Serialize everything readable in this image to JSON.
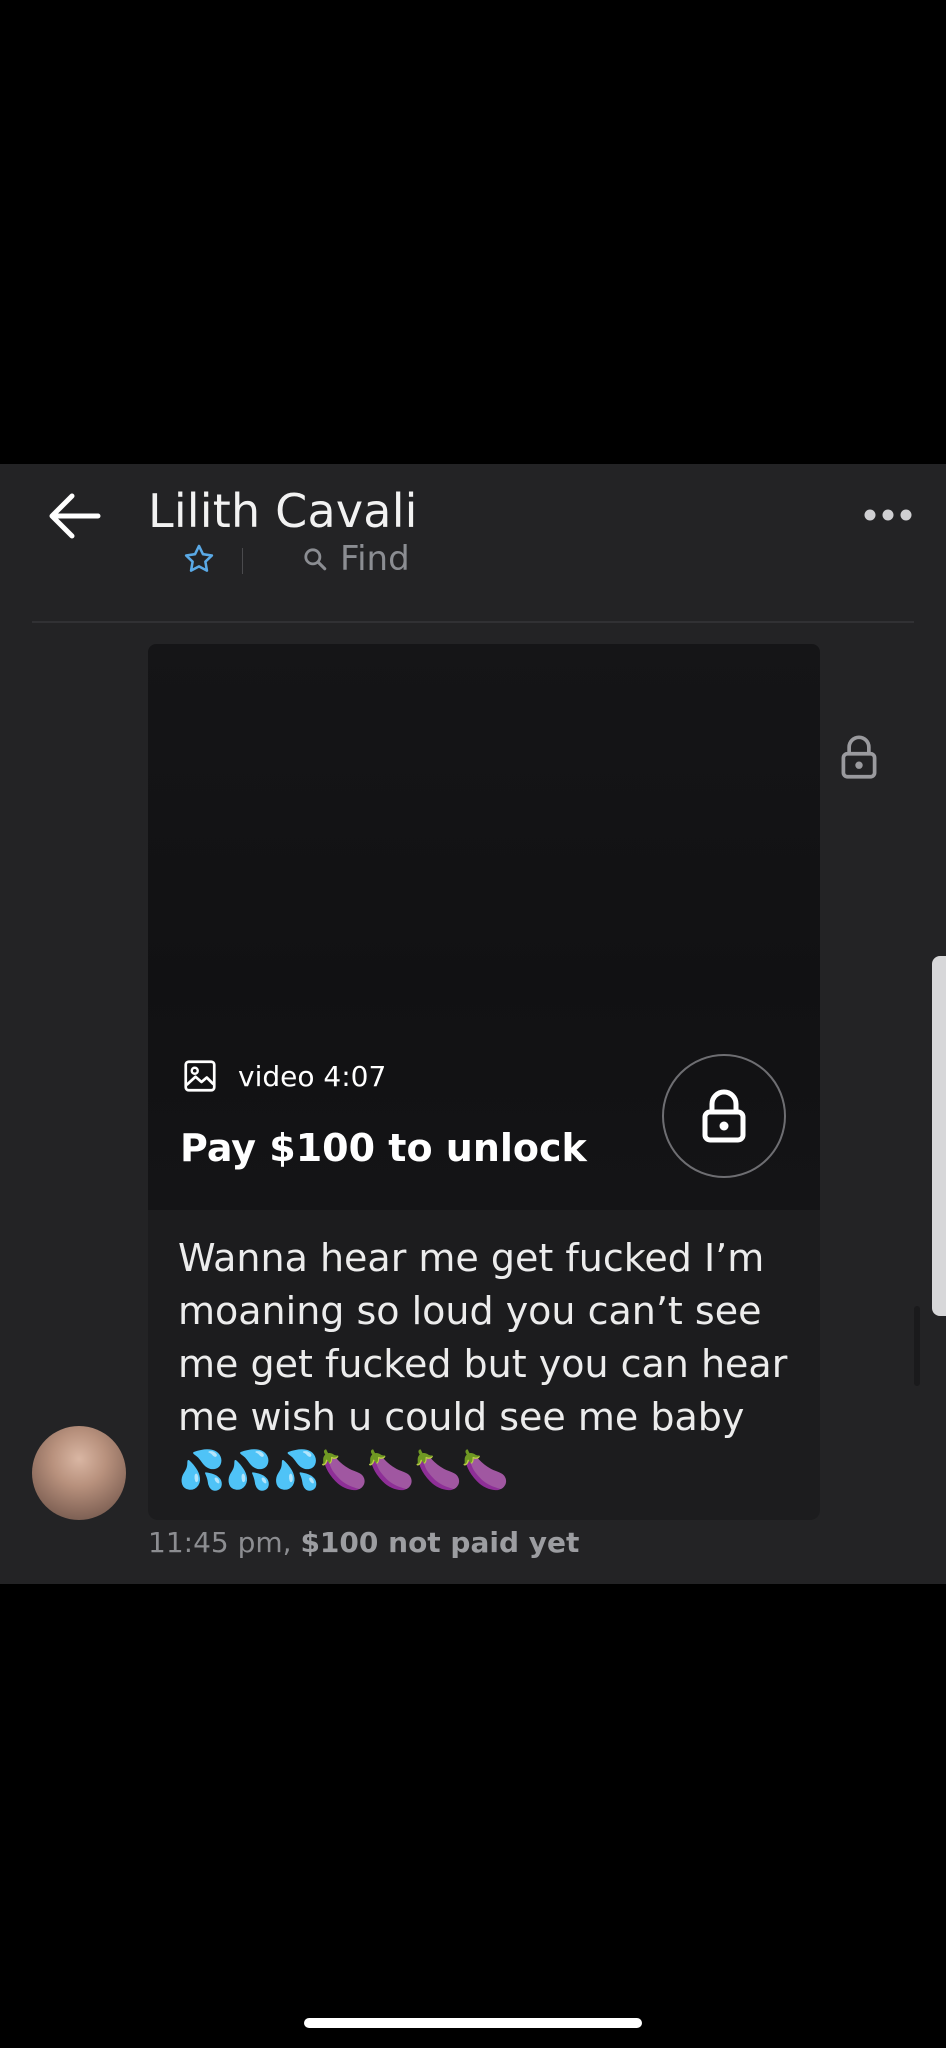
{
  "header": {
    "title": "Lilith Cavali",
    "find_label": "Find"
  },
  "post": {
    "media_label": "video 4:07",
    "pay_label": "Pay $100 to unlock"
  },
  "message": {
    "text": "Wanna hear me get fucked I’m moaning so loud you can’t see me get fucked but you can hear me wish u could see me baby 💦💦💦🍆🍆🍆🍆",
    "time": "11:45 pm,",
    "payment_status": "$100 not paid yet"
  },
  "colors": {
    "background": "#000000",
    "panel": "#232325",
    "accent_star": "#5aa9e6",
    "muted_text": "#8c8d91"
  },
  "icons": [
    "back-arrow-icon",
    "star-icon",
    "search-icon",
    "more-icon",
    "image-icon",
    "lock-icon"
  ]
}
